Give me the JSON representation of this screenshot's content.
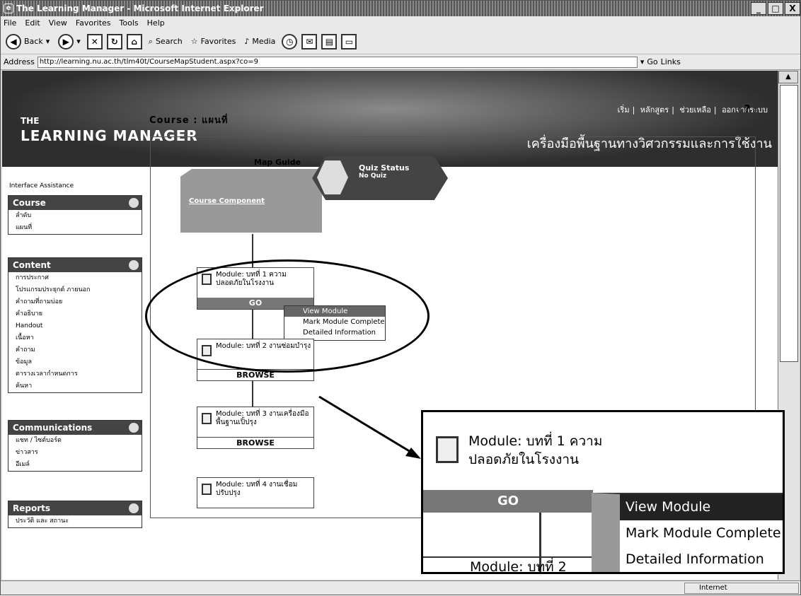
{
  "window": {
    "title": "The Learning Manager - Microsoft Internet Explorer",
    "controls": [
      "_",
      "□",
      "X"
    ]
  },
  "menu": [
    "File",
    "Edit",
    "View",
    "Favorites",
    "Tools",
    "Help"
  ],
  "toolbar": {
    "back": "Back",
    "search": "Search",
    "favorites": "Favorites",
    "media": "Media"
  },
  "address": {
    "label": "Address",
    "url": "http://learning.nu.ac.th/tlm40t/CourseMapStudent.aspx?co=9",
    "go": "Go",
    "links": "Links"
  },
  "banner": {
    "logo_small": "THE",
    "logo": "LEARNING MANAGER",
    "topnav": [
      "เริ่ม",
      "หลักสูตร",
      "ช่วยเหลือ",
      "ออกจากระบบ"
    ],
    "tagline": "เครื่องมือพื้นฐานทางวิศวกรรมและการใช้งาน"
  },
  "sidebar": {
    "assistance": "Interface Assistance",
    "panels": [
      {
        "title": "Course",
        "items": [
          "ลำดับ",
          "แผนที่"
        ]
      },
      {
        "title": "Content",
        "items": [
          "การประกาศ",
          "โปรแกรมประยุกต์ ภายนอก",
          "คำถามที่ถามบ่อย",
          "คำอธิบาย",
          "Handout",
          "เนื้อหา",
          "คำถาม",
          "ข้อมูล",
          "ตารางเวลากำหนดการ",
          "ค้นหา"
        ]
      },
      {
        "title": "Communications",
        "items": [
          "แชท / ไซต์บอร์ด",
          "ข่าวสาร",
          "อีเมล์"
        ]
      },
      {
        "title": "Reports",
        "items": [
          "ประวัติ และ สถานะ"
        ]
      }
    ]
  },
  "main": {
    "course_title": "Course : แผนที่",
    "help_icon": "?",
    "map_guide": "Map Guide",
    "course_component": "Course Component",
    "quiz_status": "Quiz Status",
    "quiz_value": "No Quiz",
    "modules": [
      {
        "title": "Module: บทที่ 1 ความปลอดภัยในโรงงาน",
        "action": "GO"
      },
      {
        "title": "Module: บทที่ 2 งานซ่อมบำรุง",
        "action": "BROWSE"
      },
      {
        "title": "Module: บทที่ 3 งานเครื่องมือพื้นฐานเปิ้ปรุง",
        "action": "BROWSE"
      },
      {
        "title": "Module: บทที่ 4 งานเชื่อมปรับปรุง",
        "action": ""
      }
    ],
    "context_menu": [
      "View Module",
      "Mark Module Complete",
      "Detailed Information"
    ]
  },
  "zoom": {
    "module_title_line1": "Module: บทที่ 1 ความ",
    "module_title_line2": "ปลอดภัยในโรงงาน",
    "go": "GO",
    "next_module": "Module: บทที่ 2",
    "menu": [
      "View Module",
      "Mark Module Complete",
      "Detailed Information"
    ]
  },
  "status": {
    "zone": "Internet"
  }
}
